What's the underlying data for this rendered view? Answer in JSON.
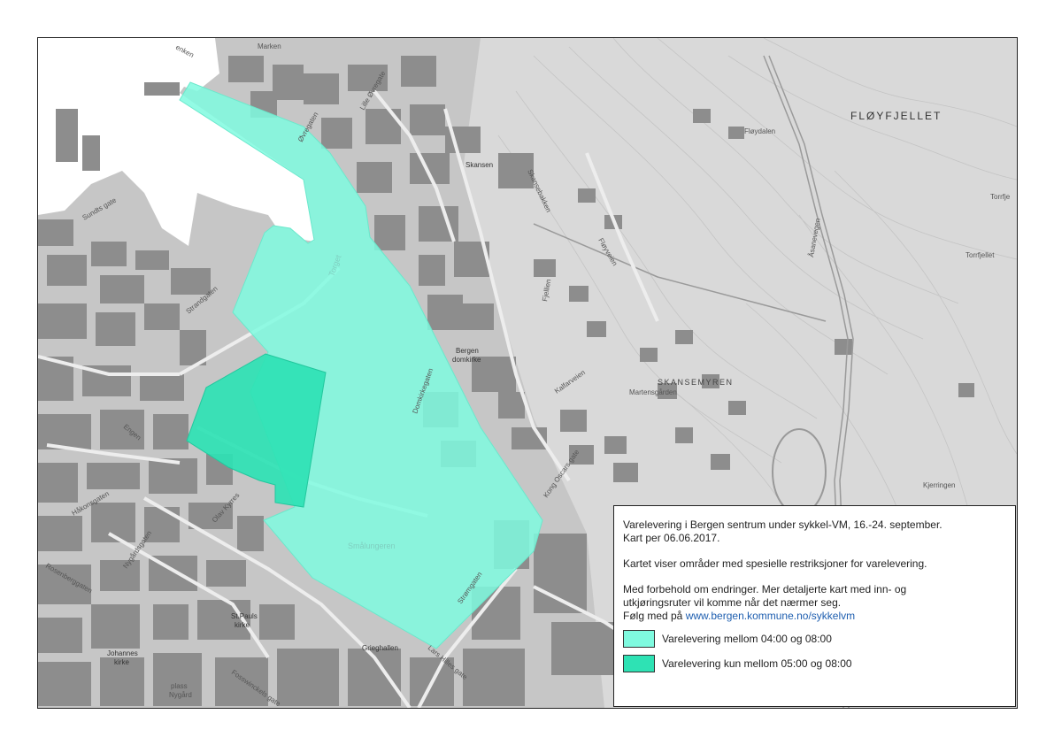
{
  "colors": {
    "zone_light": "#7ffadf",
    "zone_dark": "#2ee2b4",
    "water": "#ffffff",
    "land": "#c9c9c9",
    "buildings": "#8a8a8a",
    "link": "#1f5fb0"
  },
  "legend": {
    "title_line1": "Varelevering i Bergen sentrum under sykkel-VM, 16.-24. september.",
    "title_line2": "Kart per 06.06.2017.",
    "description": "Kartet viser områder med spesielle restriksjoner for varelevering.",
    "note_line1": "Med forbehold om endringer. Mer detaljerte kart med inn- og",
    "note_line2": "utkjøringsruter vil komme når det nærmer seg.",
    "follow_prefix": "Følg med på",
    "follow_link": "www.bergen.kommune.no/sykkelvm",
    "items": [
      {
        "label": "Varelevering mellom 04:00 og 08:00"
      },
      {
        "label": "Varelevering kun mellom 05:00 og 08:00"
      }
    ]
  },
  "map_labels": {
    "floyfjellet": "FLØYFJELLET",
    "skansemyren": "SKANSEMYREN",
    "floydalen": "Fløydalen",
    "skansen": "Skansen",
    "bergen_domkirke_1": "Bergen",
    "bergen_domkirke_2": "domkirke",
    "martensgarden": "Martensgården",
    "grieghallen": "Grieghallen",
    "johannes_kirke_1": "Johannes",
    "johannes_kirke_2": "kirke",
    "st_pauls_1": "St.Pauls",
    "st_pauls_2": "kirke",
    "nygard_1": "plass",
    "nygard_2": "Nygård",
    "kjerringen": "Kjerringen",
    "torrfjellet": "Torrfjellet",
    "torrfje": "Torrfje",
    "marken": "Marken",
    "enken": "enken",
    "ovregaten": "Øvregaten",
    "strandgaten": "Strandgaten",
    "sundts_gate": "Sundts gate",
    "engen": "Engen",
    "olav_kyrres": "Olav Kyrres",
    "haakonsgaten": "Håkonsgaten",
    "kong_oscars": "Kong Oscars gate",
    "lars_hilles": "Lars Hilles gate",
    "stromgaten": "Strømgaten",
    "asnevegen": "Åsanevegen",
    "floyveien": "Fløyveien",
    "skansebakken": "Skansebakken",
    "fjellien": "Fjellien",
    "smalungeren": "Smålungeren",
    "fosswinckels": "Fosswinckels gate",
    "rosenberg": "Rosenberggaten",
    "nygardsgaten": "Nygårdsgaten",
    "domkirkegaten": "Domkirkegaten",
    "lille_ovre": "Lille Øvregate",
    "kalfarveien": "Kalfarveien",
    "torget": "Torget",
    "kong_oscars_short": "Kong Oscars gate"
  }
}
